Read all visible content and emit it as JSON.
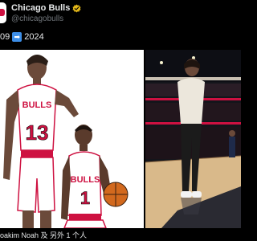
{
  "account": {
    "name": "Chicago Bulls",
    "handle": "@chicagobulls"
  },
  "tweet": {
    "text_left": "09",
    "arrow_emoji": "➡",
    "text_right": "2024"
  },
  "media": {
    "left_image_desc_jerseys": [
      "13",
      "1"
    ],
    "jersey_text": "BULLS"
  },
  "caption": "oakim Noah 及 另外 1 个人",
  "colors": {
    "bulls_red": "#ce1141",
    "verified_gold": "#e2b719",
    "background": "#000000"
  }
}
